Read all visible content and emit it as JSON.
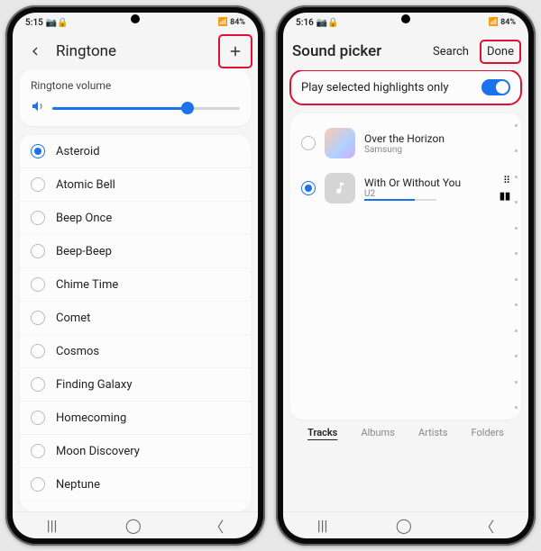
{
  "left": {
    "status": {
      "time": "5:15",
      "icons": "📷🔒",
      "right": "📶 84%"
    },
    "title": "Ringtone",
    "volume": {
      "label": "Ringtone volume",
      "percent": 72
    },
    "ringtones": [
      {
        "label": "Asteroid",
        "selected": true
      },
      {
        "label": "Atomic Bell",
        "selected": false
      },
      {
        "label": "Beep Once",
        "selected": false
      },
      {
        "label": "Beep-Beep",
        "selected": false
      },
      {
        "label": "Chime Time",
        "selected": false
      },
      {
        "label": "Comet",
        "selected": false
      },
      {
        "label": "Cosmos",
        "selected": false
      },
      {
        "label": "Finding Galaxy",
        "selected": false
      },
      {
        "label": "Homecoming",
        "selected": false
      },
      {
        "label": "Moon Discovery",
        "selected": false
      },
      {
        "label": "Neptune",
        "selected": false
      }
    ]
  },
  "right": {
    "status": {
      "time": "5:16",
      "icons": "📷🔒",
      "right": "📶 84%"
    },
    "title": "Sound picker",
    "actions": {
      "search": "Search",
      "done": "Done"
    },
    "highlights_label": "Play selected highlights only",
    "songs": [
      {
        "title": "Over the Horizon",
        "artist": "Samsung",
        "selected": false,
        "playing": false
      },
      {
        "title": "With Or Without You",
        "artist": "U2",
        "selected": true,
        "playing": true
      }
    ],
    "tabs": [
      {
        "label": "Tracks",
        "active": true
      },
      {
        "label": "Albums",
        "active": false
      },
      {
        "label": "Artists",
        "active": false
      },
      {
        "label": "Folders",
        "active": false
      }
    ]
  }
}
